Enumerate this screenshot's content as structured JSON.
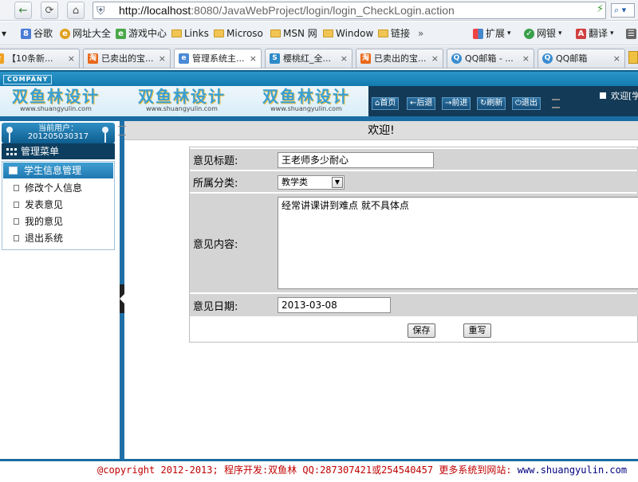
{
  "browser": {
    "url_host": "http://localhost",
    "url_rest": ":8080/JavaWebProject/login/login_CheckLogin.action",
    "bookmarks": [
      "谷歌",
      "网址大全",
      "游戏中心",
      "Links",
      "Microso",
      "MSN 网",
      "Window",
      "链接"
    ],
    "bookmark_more": "»",
    "right_tools": [
      "扩展",
      "网银",
      "翻译"
    ],
    "tabs": [
      "【10条新...",
      "已卖出的宝...",
      "管理系统主...",
      "樱桃红_全...",
      "已卖出的宝...",
      "QQ邮箱 - ...",
      "QQ邮箱"
    ],
    "active_tab": 2,
    "tab_close": "×",
    "dropdown_glyph": "▾"
  },
  "header": {
    "company": "COMPANY",
    "logo_cn": "双鱼林设计",
    "logo_en": "www.shuangyulin.com",
    "nav": [
      "首页",
      "后退",
      "前进",
      "刷新",
      "退出"
    ],
    "welcome_user": "欢迎[学"
  },
  "sidebar": {
    "current_user_label": "当前用户：",
    "current_user_id": "201205030317",
    "menu_title": "管理菜单",
    "section_title": "学生信息管理",
    "items": [
      "修改个人信息",
      "发表意见",
      "我的意见",
      "退出系统"
    ]
  },
  "content": {
    "title": "欢迎!",
    "form": {
      "title_label": "意见标题:",
      "title_value": "王老师多少耐心",
      "category_label": "所属分类:",
      "category_value": "教学类",
      "content_label": "意见内容:",
      "content_value": "经常讲课讲到难点 就不具体点",
      "date_label": "意见日期:",
      "date_value": "2013-03-08",
      "save_label": "保存",
      "reset_label": "重写"
    }
  },
  "footer": {
    "text": "@copyright 2012-2013; 程序开发:双鱼林  QQ:287307421或254540457  更多系统到网站: ",
    "site": "www.shuangyulin.com"
  }
}
